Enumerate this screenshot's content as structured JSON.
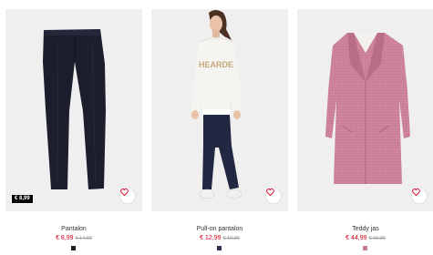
{
  "products": [
    {
      "name": "Pantalon",
      "price": "€ 8,99",
      "old_price": "€ 14,99",
      "badge": "€ 8,99",
      "image": "navy-trousers",
      "swatch_color": "#1a1d2c"
    },
    {
      "name": "Pull-on pantalon",
      "price": "€ 12,99",
      "old_price": "€ 19,99",
      "image": "model-in-sweatshirt-and-pull-on-trousers",
      "sweatshirt_text": "HEARDE",
      "swatch_color": "#2a3550"
    },
    {
      "name": "Teddy jas",
      "price": "€ 44,99",
      "old_price": "€ 69,99",
      "image": "pink-teddy-coat",
      "swatch_color": "#c57f93"
    }
  ],
  "icons": {
    "favorite": "heart-icon"
  },
  "colors": {
    "sale": "#d6001c",
    "old_price": "#9a9a9a",
    "tile_bg": "#efefef"
  }
}
